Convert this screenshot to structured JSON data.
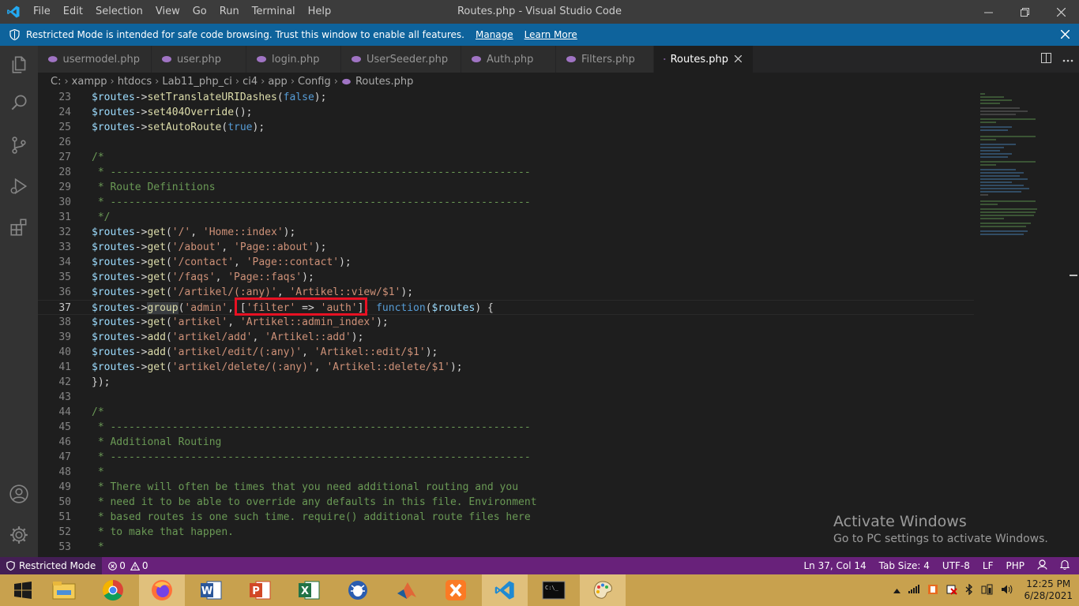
{
  "window": {
    "title": "Routes.php - Visual Studio Code",
    "menu": [
      "File",
      "Edit",
      "Selection",
      "View",
      "Go",
      "Run",
      "Terminal",
      "Help"
    ]
  },
  "banner": {
    "text": "Restricted Mode is intended for safe code browsing. Trust this window to enable all features.",
    "manage": "Manage",
    "learn_more": "Learn More"
  },
  "tabs": [
    {
      "label": "usermodel.php"
    },
    {
      "label": "user.php"
    },
    {
      "label": "login.php"
    },
    {
      "label": "UserSeeder.php"
    },
    {
      "label": "Auth.php"
    },
    {
      "label": "Filters.php"
    },
    {
      "label": "Routes.php"
    }
  ],
  "breadcrumb": [
    "C:",
    "xampp",
    "htdocs",
    "Lab11_php_ci",
    "ci4",
    "app",
    "Config",
    "Routes.php"
  ],
  "editor": {
    "lines": [
      {
        "n": "23"
      },
      {
        "n": "24"
      },
      {
        "n": "25"
      },
      {
        "n": "26"
      },
      {
        "n": "27"
      },
      {
        "n": "28"
      },
      {
        "n": "29"
      },
      {
        "n": "30"
      },
      {
        "n": "31"
      },
      {
        "n": "32"
      },
      {
        "n": "33"
      },
      {
        "n": "34"
      },
      {
        "n": "35"
      },
      {
        "n": "36"
      },
      {
        "n": "37"
      },
      {
        "n": "38"
      },
      {
        "n": "39"
      },
      {
        "n": "40"
      },
      {
        "n": "41"
      },
      {
        "n": "42"
      },
      {
        "n": "43"
      },
      {
        "n": "44"
      },
      {
        "n": "45"
      },
      {
        "n": "46"
      },
      {
        "n": "47"
      },
      {
        "n": "48"
      },
      {
        "n": "49"
      },
      {
        "n": "50"
      },
      {
        "n": "51"
      },
      {
        "n": "52"
      },
      {
        "n": "53"
      }
    ],
    "code": {
      "l23": "setTranslateURIDashes",
      "l23a": "false",
      "l24": "set404Override",
      "l25": "setAutoRoute",
      "l25a": "true",
      "l28": " * --------------------------------------------------------------------",
      "l29": " * Route Definitions",
      "l30": " * --------------------------------------------------------------------",
      "l31": " */",
      "l27": "/*",
      "l32a": "'/'",
      "l32b": "'Home::index'",
      "l33a": "'/about'",
      "l33b": "'Page::about'",
      "l34a": "'/contact'",
      "l34b": "'Page::contact'",
      "l35a": "'/faqs'",
      "l35b": "'Page::faqs'",
      "l36a": "'/artikel/(:any)'",
      "l36b": "'Artikel::view/$1'",
      "l37fn": "group",
      "l37a": "'admin'",
      "l37b": "'filter'",
      "l37arrow": " => ",
      "l37c": "'auth'",
      "l37kw": "function",
      "l37v": "$routes",
      "l38a": "'artikel'",
      "l38b": "'Artikel::admin_index'",
      "l39a": "'artikel/add'",
      "l39b": "'Artikel::add'",
      "l40a": "'artikel/edit/(:any)'",
      "l40b": "'Artikel::edit/$1'",
      "l41a": "'artikel/delete/(:any)'",
      "l41b": "'Artikel::delete/$1'",
      "l42": "});",
      "l44": "/*",
      "l45": " * --------------------------------------------------------------------",
      "l46": " * Additional Routing",
      "l47": " * --------------------------------------------------------------------",
      "l48": " *",
      "l49": " * There will often be times that you need additional routing and you",
      "l50": " * need it to be able to override any defaults in this file. Environment",
      "l51": " * based routes is one such time. require() additional route files here",
      "l52": " * to make that happen.",
      "l53": " *",
      "var": "$routes",
      "arrow": "->",
      "get": "get",
      "add": "add"
    }
  },
  "watermark": {
    "title": "Activate Windows",
    "subtitle": "Go to PC settings to activate Windows."
  },
  "statusbar": {
    "restricted": "Restricted Mode",
    "errors": "0",
    "warnings": "0",
    "position": "Ln 37, Col 14",
    "tab_size": "Tab Size: 4",
    "encoding": "UTF-8",
    "eol": "LF",
    "language": "PHP"
  },
  "taskbar": {
    "time": "12:25 PM",
    "date": "6/28/2021",
    "apps": [
      "start-icon",
      "file-explorer-icon",
      "chrome-icon",
      "firefox-icon",
      "word-icon",
      "powerpoint-icon",
      "excel-icon",
      "debugger-icon",
      "matlab-icon",
      "xampp-icon",
      "vscode-icon",
      "cmd-icon",
      "paint-icon"
    ]
  },
  "colors": {
    "statusbar": "#68217a",
    "banner": "#0e639c",
    "taskbar": "#c8a14e",
    "highlight_box": "#e81123"
  }
}
